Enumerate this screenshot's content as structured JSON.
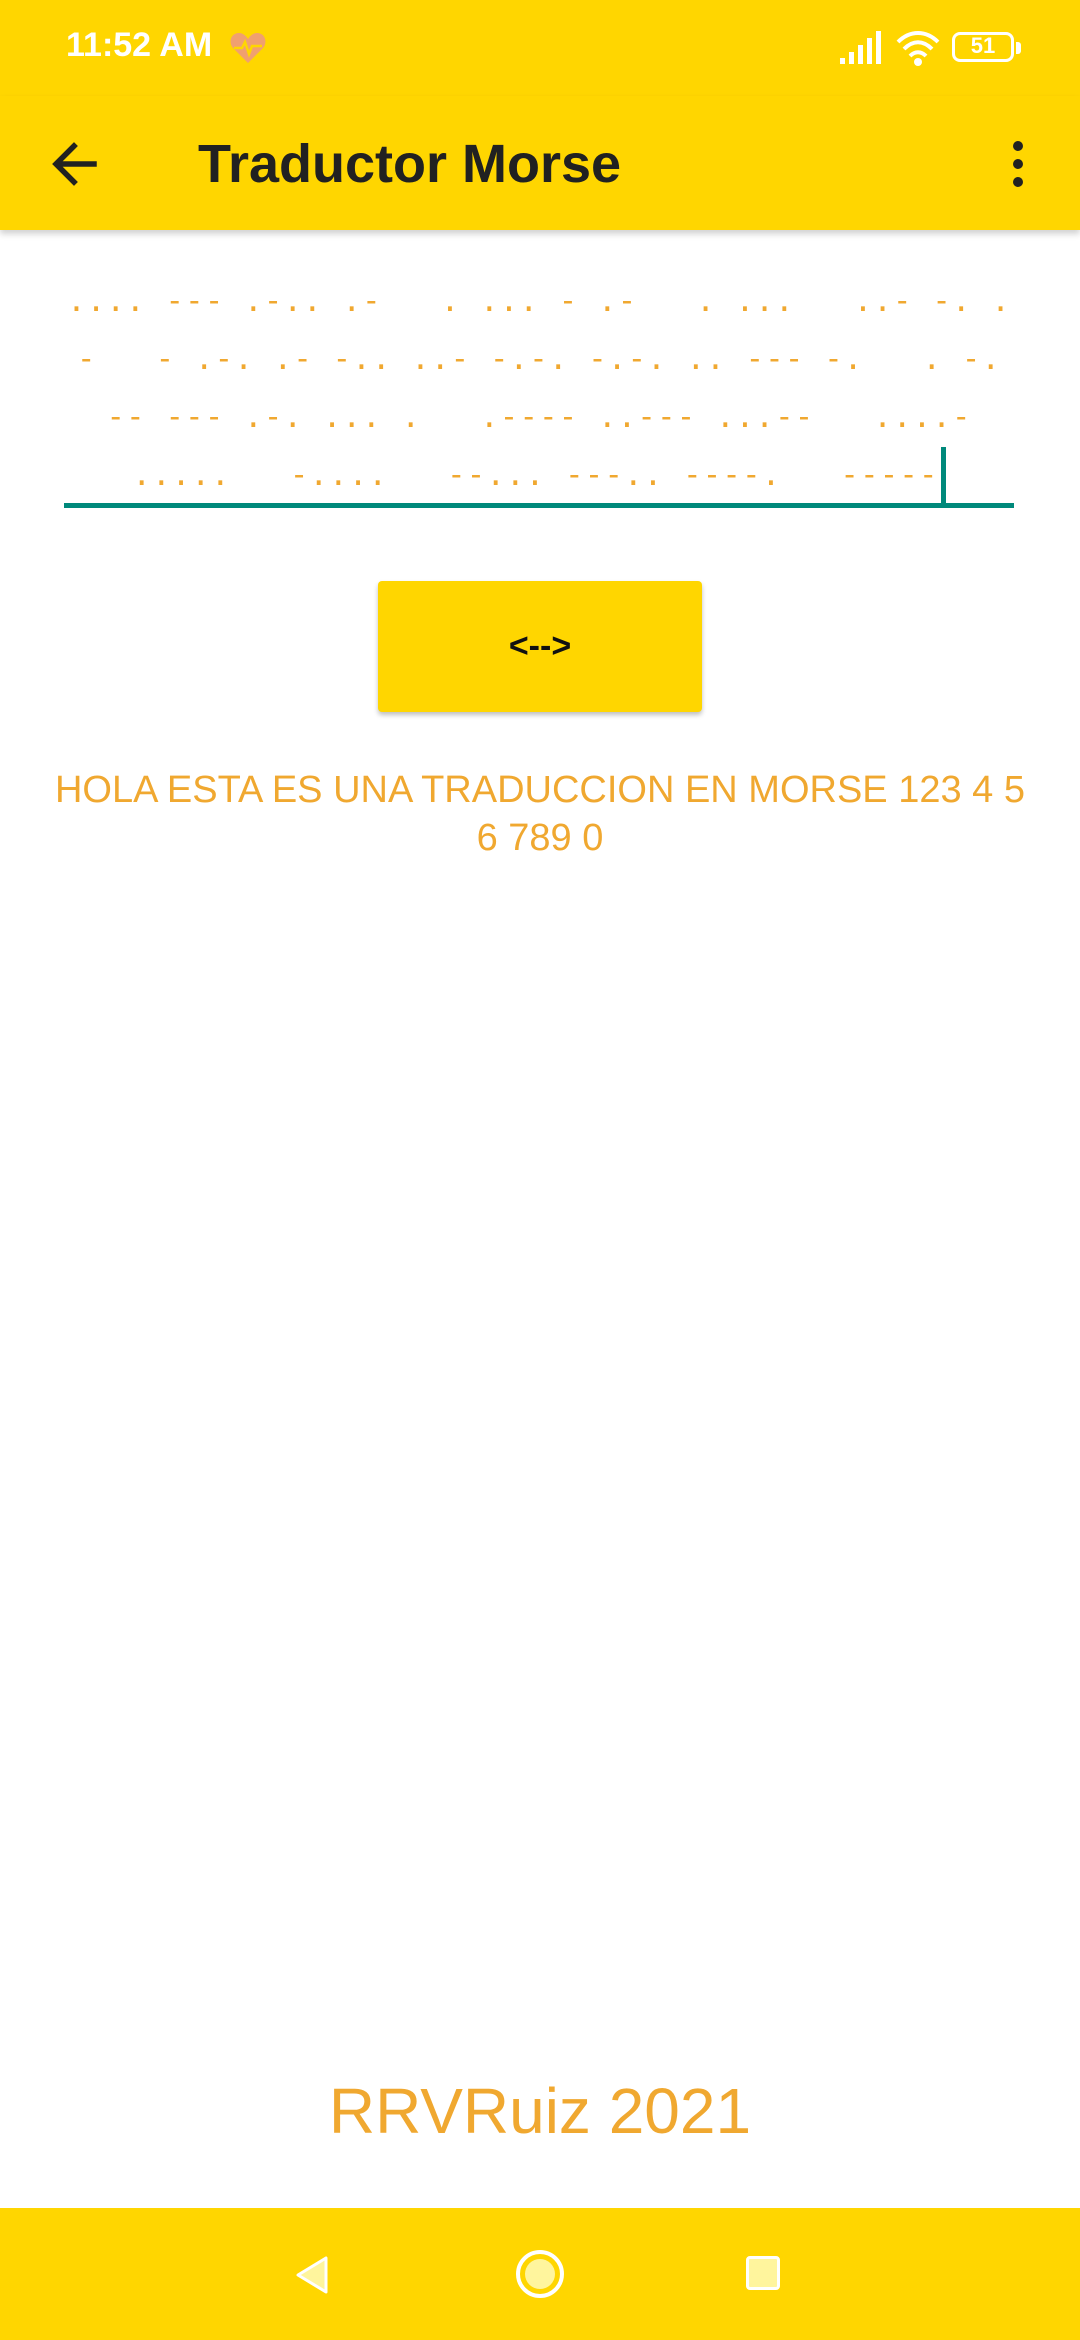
{
  "status_bar": {
    "time": "11:52 AM",
    "battery": "51",
    "icons": [
      "heart-monitor-icon",
      "signal-icon",
      "wifi-icon",
      "battery-icon"
    ]
  },
  "app_bar": {
    "title": "Traductor Morse",
    "back_icon": "arrow-left-icon",
    "menu_icon": "more-vert-icon"
  },
  "input": {
    "value": ".... --- .-.. .-   . ... - .-   . ...   ..- -. .-   - .-. .- -.. ..- -.-. -.-. .. --- -.   . -.   -- --- .-. ... .   .---- ..--- ...--   ....-   .....   -....   --... ---.. ----.   -----"
  },
  "translate_button": {
    "label": "<-->"
  },
  "output": {
    "text": "HOLA ESTA ES UNA TRADUCCION EN MORSE 123 4 5 6 789 0"
  },
  "footer": {
    "credit": "RRVRuiz 2021"
  },
  "colors": {
    "primary": "#FFD600",
    "text_accent": "#F0A830",
    "underline": "#00897B",
    "title": "#212121"
  },
  "nav_bar": {
    "icons": [
      "nav-back-icon",
      "nav-home-icon",
      "nav-recents-icon"
    ]
  }
}
